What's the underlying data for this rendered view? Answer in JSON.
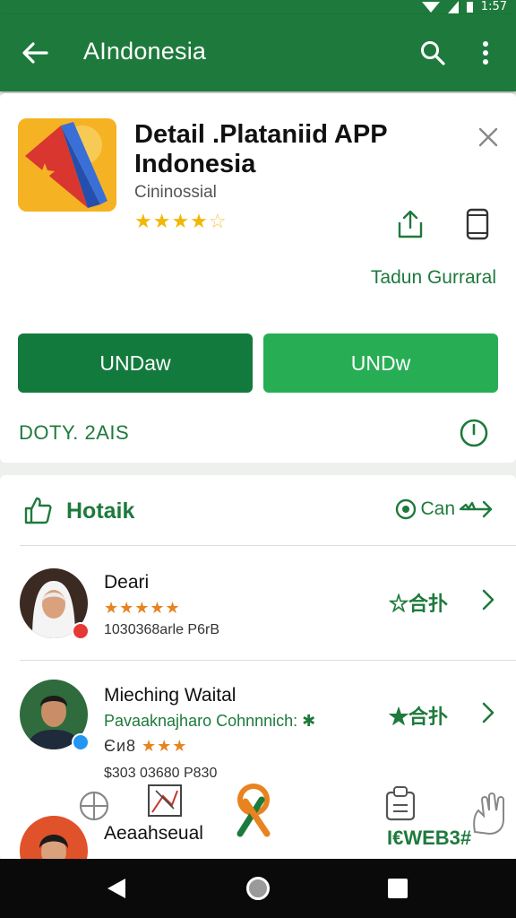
{
  "status_bar": {
    "time": "1:57"
  },
  "app_bar": {
    "title": "AIndonesia"
  },
  "app_detail": {
    "name": "Detail .Plataniid APP Indonesia",
    "developer": "Cininossial",
    "rating_stars": "★★★★",
    "rating_half": "☆",
    "secondary_link": "Tadun Gurraral",
    "primary_button": "UNDаw",
    "secondary_button": "UNDw",
    "meta_text": "DOTY. 2AIS"
  },
  "reviews_section": {
    "title": "Hotaik",
    "link": "Can",
    "reviews": [
      {
        "name": "Deari",
        "stars": "★★★★★",
        "sub": "1030368аrle P6rB",
        "action": "☆合扑",
        "badge_color": "#e53935"
      },
      {
        "name": "Mieching Waital",
        "stars": "★★★",
        "prefix": "Єи8",
        "sub": "Pavaaknajharo Cohnnnich: ✱",
        "sub2": "$303 03680 P830",
        "action": "★合扑",
        "badge_color": "#2196f3"
      },
      {
        "name": "Aeaahseual",
        "action": "I€WEB3#",
        "badge_color": "#1e7a3c"
      }
    ]
  },
  "colors": {
    "brand": "#1e7a3c",
    "accent": "#27ae55",
    "star": "#f2b705"
  }
}
